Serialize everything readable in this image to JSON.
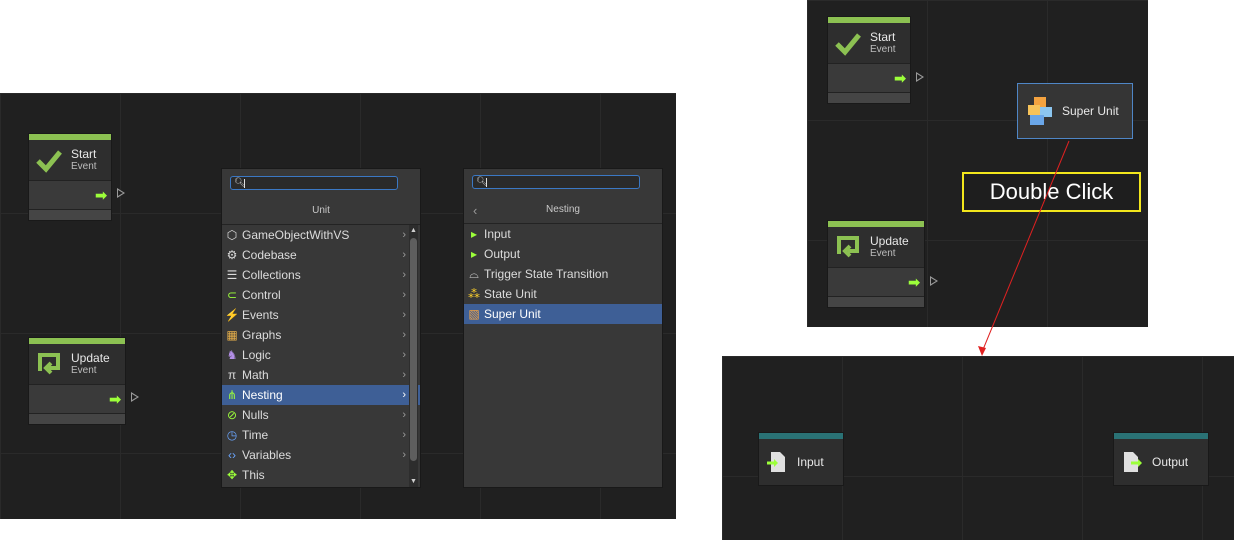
{
  "nodes": {
    "start": {
      "title": "Start",
      "subtitle": "Event"
    },
    "update": {
      "title": "Update",
      "subtitle": "Event"
    },
    "super_unit": {
      "title": "Super Unit"
    },
    "input": {
      "title": "Input"
    },
    "output": {
      "title": "Output"
    }
  },
  "unit_panel": {
    "title": "Unit",
    "search_value": "",
    "items": [
      {
        "label": "GameObjectWithVS",
        "icon": "cube-icon"
      },
      {
        "label": "Codebase",
        "icon": "gear-icon"
      },
      {
        "label": "Collections",
        "icon": "list-icon"
      },
      {
        "label": "Control",
        "icon": "control-icon"
      },
      {
        "label": "Events",
        "icon": "lightning-icon"
      },
      {
        "label": "Graphs",
        "icon": "graphs-icon"
      },
      {
        "label": "Logic",
        "icon": "logic-icon"
      },
      {
        "label": "Math",
        "icon": "pi-icon"
      },
      {
        "label": "Nesting",
        "icon": "nesting-icon",
        "selected": true
      },
      {
        "label": "Nulls",
        "icon": "null-icon"
      },
      {
        "label": "Time",
        "icon": "clock-icon"
      },
      {
        "label": "Variables",
        "icon": "variables-icon"
      },
      {
        "label": "This",
        "icon": "this-icon"
      }
    ]
  },
  "nesting_panel": {
    "title": "Nesting",
    "search_value": "",
    "items": [
      {
        "label": "Input",
        "icon": "input-icon"
      },
      {
        "label": "Output",
        "icon": "output-icon"
      },
      {
        "label": "Trigger State Transition",
        "icon": "trigger-icon"
      },
      {
        "label": "State Unit",
        "icon": "state-unit-icon"
      },
      {
        "label": "Super Unit",
        "icon": "super-unit-icon",
        "selected": true
      }
    ]
  },
  "callout": {
    "text": "Double Click"
  },
  "colors": {
    "event_bar": "#8cc152",
    "nest_bar": "#2a7275",
    "selection": "#3e5f96",
    "flow_arrow": "#9cff3a",
    "callout_border": "#f2e61c",
    "link": "#e02020"
  }
}
